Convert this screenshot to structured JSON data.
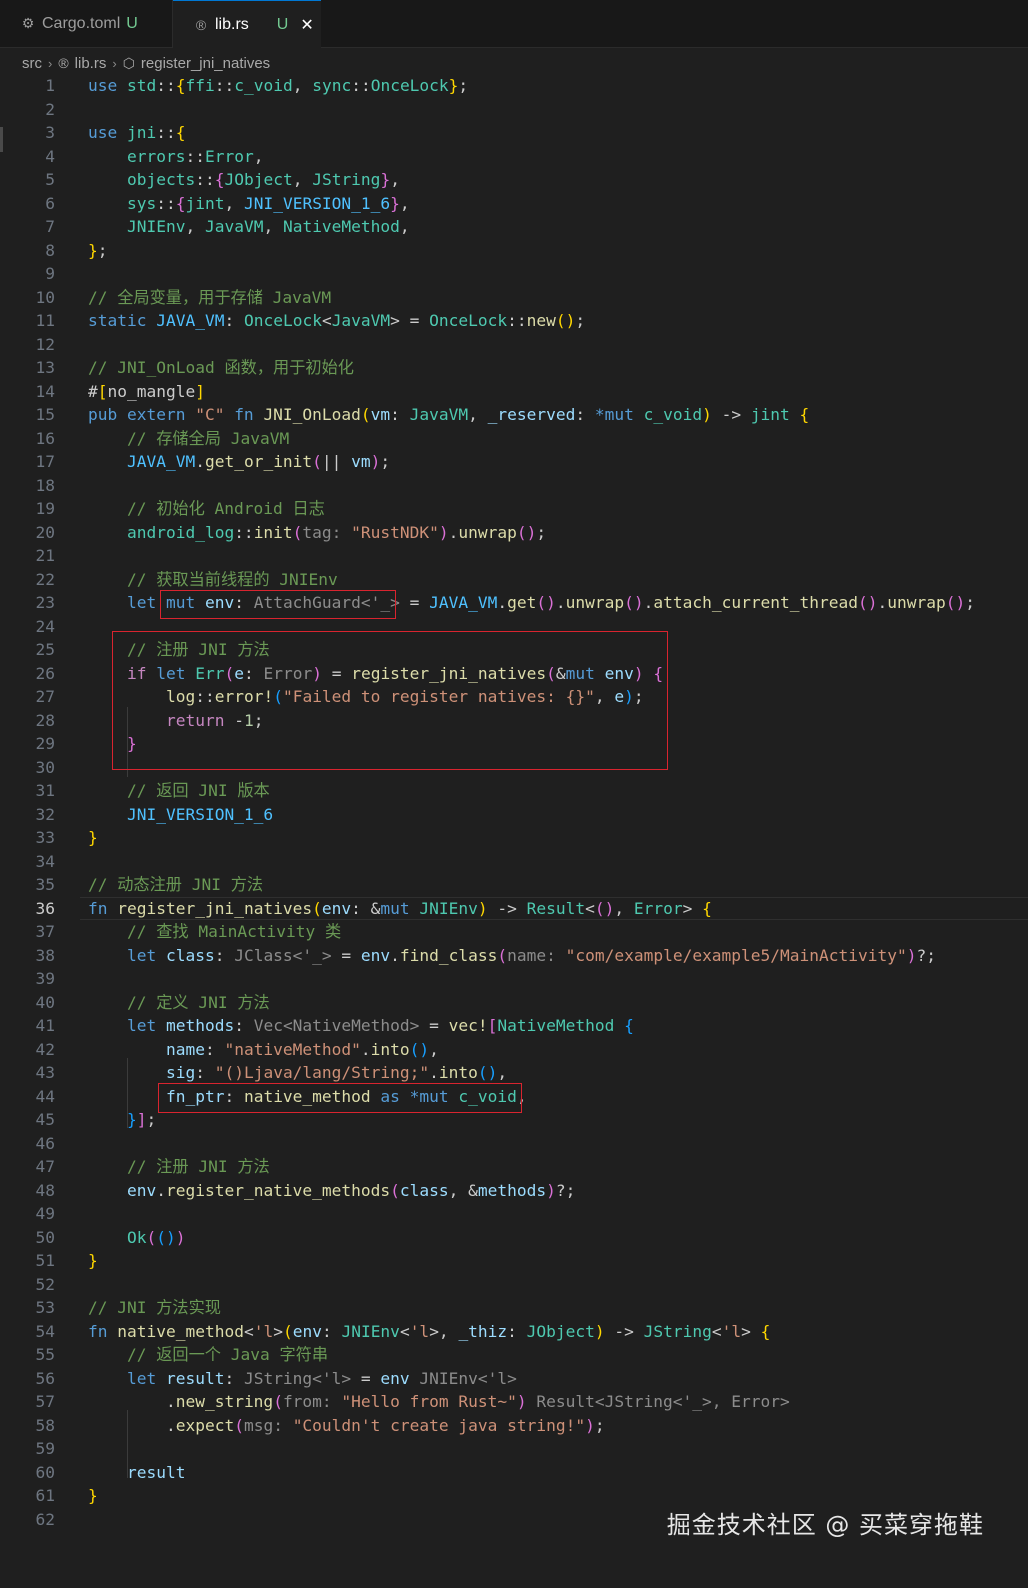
{
  "tabs": [
    {
      "icon": "gear-icon",
      "label": "Cargo.toml",
      "status": "U"
    },
    {
      "icon": "rust-icon",
      "label": "lib.rs",
      "status": "U",
      "close": "✕"
    }
  ],
  "breadcrumb": [
    "src",
    "lib.rs",
    "register_jni_natives"
  ],
  "active_line": 36,
  "lines": [
    [
      [
        "k",
        "use "
      ],
      [
        "t",
        "std"
      ],
      [
        "p",
        "::"
      ],
      [
        "y",
        "{"
      ],
      [
        "t",
        "ffi"
      ],
      [
        "p",
        "::"
      ],
      [
        "t",
        "c_void"
      ],
      [
        "p",
        ", "
      ],
      [
        "t",
        "sync"
      ],
      [
        "p",
        "::"
      ],
      [
        "t",
        "OnceLock"
      ],
      [
        "y",
        "}"
      ],
      [
        "p",
        ";"
      ]
    ],
    [],
    [
      [
        "k",
        "use "
      ],
      [
        "t",
        "jni"
      ],
      [
        "p",
        "::"
      ],
      [
        "y",
        "{"
      ]
    ],
    [
      [
        "p",
        "    "
      ],
      [
        "t",
        "errors"
      ],
      [
        "p",
        "::"
      ],
      [
        "t",
        "Error"
      ],
      [
        "p",
        ","
      ]
    ],
    [
      [
        "p",
        "    "
      ],
      [
        "t",
        "objects"
      ],
      [
        "p",
        "::"
      ],
      [
        "pk",
        "{"
      ],
      [
        "t",
        "JObject"
      ],
      [
        "p",
        ", "
      ],
      [
        "t",
        "JString"
      ],
      [
        "pk",
        "}"
      ],
      [
        "p",
        ","
      ]
    ],
    [
      [
        "p",
        "    "
      ],
      [
        "t",
        "sys"
      ],
      [
        "p",
        "::"
      ],
      [
        "pk",
        "{"
      ],
      [
        "t",
        "jint"
      ],
      [
        "p",
        ", "
      ],
      [
        "cn",
        "JNI_VERSION_1_6"
      ],
      [
        "pk",
        "}"
      ],
      [
        "p",
        ","
      ]
    ],
    [
      [
        "p",
        "    "
      ],
      [
        "t",
        "JNIEnv"
      ],
      [
        "p",
        ", "
      ],
      [
        "t",
        "JavaVM"
      ],
      [
        "p",
        ", "
      ],
      [
        "t",
        "NativeMethod"
      ],
      [
        "p",
        ","
      ]
    ],
    [
      [
        "y",
        "}"
      ],
      [
        "p",
        ";"
      ]
    ],
    [],
    [
      [
        "c",
        "// 全局变量，用于存储 JavaVM"
      ]
    ],
    [
      [
        "k",
        "static "
      ],
      [
        "cn",
        "JAVA_VM"
      ],
      [
        "p",
        ": "
      ],
      [
        "t",
        "OnceLock"
      ],
      [
        "p",
        "<"
      ],
      [
        "t",
        "JavaVM"
      ],
      [
        "p",
        "> = "
      ],
      [
        "t",
        "OnceLock"
      ],
      [
        "p",
        "::"
      ],
      [
        "f",
        "new"
      ],
      [
        "y",
        "()"
      ],
      [
        "p",
        ";"
      ]
    ],
    [],
    [
      [
        "c",
        "// JNI_OnLoad 函数，用于初始化"
      ]
    ],
    [
      [
        "p",
        "#"
      ],
      [
        "y",
        "["
      ],
      [
        "p",
        "no_mangle"
      ],
      [
        "y",
        "]"
      ]
    ],
    [
      [
        "k",
        "pub extern "
      ],
      [
        "s",
        "\"C\" "
      ],
      [
        "k",
        "fn "
      ],
      [
        "f",
        "JNI_OnLoad"
      ],
      [
        "y",
        "("
      ],
      [
        "v",
        "vm"
      ],
      [
        "p",
        ": "
      ],
      [
        "t",
        "JavaVM"
      ],
      [
        "p",
        ", "
      ],
      [
        "v",
        "_reserved"
      ],
      [
        "p",
        ": "
      ],
      [
        "k",
        "*mut "
      ],
      [
        "t",
        "c_void"
      ],
      [
        "y",
        ")"
      ],
      [
        "p",
        " -> "
      ],
      [
        "t",
        "jint"
      ],
      [
        "p",
        " "
      ],
      [
        "y",
        "{"
      ]
    ],
    [
      [
        "p",
        "    "
      ],
      [
        "c",
        "// 存储全局 JavaVM"
      ]
    ],
    [
      [
        "p",
        "    "
      ],
      [
        "cn",
        "JAVA_VM"
      ],
      [
        "p",
        "."
      ],
      [
        "f",
        "get_or_init"
      ],
      [
        "pk",
        "("
      ],
      [
        "p",
        "|| "
      ],
      [
        "v",
        "vm"
      ],
      [
        "pk",
        ")"
      ],
      [
        "p",
        ";"
      ]
    ],
    [],
    [
      [
        "p",
        "    "
      ],
      [
        "c",
        "// 初始化 Android 日志"
      ]
    ],
    [
      [
        "p",
        "    "
      ],
      [
        "t",
        "android_log"
      ],
      [
        "p",
        "::"
      ],
      [
        "f",
        "init"
      ],
      [
        "pk",
        "("
      ],
      [
        "h",
        "tag: "
      ],
      [
        "s",
        "\"RustNDK\""
      ],
      [
        "pk",
        ")"
      ],
      [
        "p",
        "."
      ],
      [
        "f",
        "unwrap"
      ],
      [
        "pk",
        "()"
      ],
      [
        "p",
        ";"
      ]
    ],
    [],
    [
      [
        "p",
        "    "
      ],
      [
        "c",
        "// 获取当前线程的 JNIEnv"
      ]
    ],
    [
      [
        "p",
        "    "
      ],
      [
        "k",
        "let "
      ],
      [
        "k",
        "mut "
      ],
      [
        "v",
        "env"
      ],
      [
        "p",
        ": "
      ],
      [
        "h",
        "AttachGuard<'_>"
      ],
      [
        "p",
        " = "
      ],
      [
        "cn",
        "JAVA_VM"
      ],
      [
        "p",
        "."
      ],
      [
        "f",
        "get"
      ],
      [
        "pk",
        "()"
      ],
      [
        "p",
        "."
      ],
      [
        "f",
        "unwrap"
      ],
      [
        "pk",
        "()"
      ],
      [
        "p",
        "."
      ],
      [
        "f",
        "attach_current_thread"
      ],
      [
        "pk",
        "()"
      ],
      [
        "p",
        "."
      ],
      [
        "f",
        "unwrap"
      ],
      [
        "pk",
        "()"
      ],
      [
        "p",
        ";"
      ]
    ],
    [],
    [
      [
        "p",
        "    "
      ],
      [
        "c",
        "// 注册 JNI 方法"
      ]
    ],
    [
      [
        "p",
        "    "
      ],
      [
        "m",
        "if "
      ],
      [
        "k",
        "let "
      ],
      [
        "t",
        "Err"
      ],
      [
        "pk",
        "("
      ],
      [
        "v",
        "e"
      ],
      [
        "p",
        ": "
      ],
      [
        "h",
        "Error"
      ],
      [
        "pk",
        ")"
      ],
      [
        "p",
        " = "
      ],
      [
        "f",
        "register_jni_natives"
      ],
      [
        "pk",
        "("
      ],
      [
        "p",
        "&"
      ],
      [
        "k",
        "mut "
      ],
      [
        "v",
        "env"
      ],
      [
        "pk",
        ")"
      ],
      [
        "p",
        " "
      ],
      [
        "pk",
        "{"
      ]
    ],
    [
      [
        "p",
        "        "
      ],
      [
        "f",
        "log"
      ],
      [
        "p",
        "::"
      ],
      [
        "f",
        "error!"
      ],
      [
        "bl",
        "("
      ],
      [
        "s",
        "\"Failed to register natives: {}\""
      ],
      [
        "p",
        ", "
      ],
      [
        "v",
        "e"
      ],
      [
        "bl",
        ")"
      ],
      [
        "p",
        ";"
      ]
    ],
    [
      [
        "p",
        "        "
      ],
      [
        "m",
        "return "
      ],
      [
        "p",
        "-"
      ],
      [
        "n",
        "1"
      ],
      [
        "p",
        ";"
      ]
    ],
    [
      [
        "p",
        "    "
      ],
      [
        "pk",
        "}"
      ]
    ],
    [],
    [
      [
        "p",
        "    "
      ],
      [
        "c",
        "// 返回 JNI 版本"
      ]
    ],
    [
      [
        "p",
        "    "
      ],
      [
        "cn",
        "JNI_VERSION_1_6"
      ]
    ],
    [
      [
        "y",
        "}"
      ]
    ],
    [],
    [
      [
        "c",
        "// 动态注册 JNI 方法"
      ]
    ],
    [
      [
        "k",
        "fn "
      ],
      [
        "f",
        "register_jni_natives"
      ],
      [
        "y",
        "("
      ],
      [
        "v",
        "env"
      ],
      [
        "p",
        ": &"
      ],
      [
        "k",
        "mut "
      ],
      [
        "t",
        "JNIEnv"
      ],
      [
        "y",
        ")"
      ],
      [
        "p",
        " -> "
      ],
      [
        "t",
        "Result"
      ],
      [
        "p",
        "<"
      ],
      [
        "pk",
        "()"
      ],
      [
        "p",
        ", "
      ],
      [
        "t",
        "Error"
      ],
      [
        "p",
        "> "
      ],
      [
        "y",
        "{"
      ]
    ],
    [
      [
        "p",
        "    "
      ],
      [
        "c",
        "// 查找 MainActivity 类"
      ]
    ],
    [
      [
        "p",
        "    "
      ],
      [
        "k",
        "let "
      ],
      [
        "v",
        "class"
      ],
      [
        "p",
        ": "
      ],
      [
        "h",
        "JClass<'_>"
      ],
      [
        "p",
        " = "
      ],
      [
        "v",
        "env"
      ],
      [
        "p",
        "."
      ],
      [
        "f",
        "find_class"
      ],
      [
        "pk",
        "("
      ],
      [
        "h",
        "name: "
      ],
      [
        "s",
        "\"com/example/example5/MainActivity\""
      ],
      [
        "pk",
        ")"
      ],
      [
        "p",
        "?;"
      ]
    ],
    [],
    [
      [
        "p",
        "    "
      ],
      [
        "c",
        "// 定义 JNI 方法"
      ]
    ],
    [
      [
        "p",
        "    "
      ],
      [
        "k",
        "let "
      ],
      [
        "v",
        "methods"
      ],
      [
        "p",
        ": "
      ],
      [
        "h",
        "Vec<NativeMethod>"
      ],
      [
        "p",
        " = "
      ],
      [
        "f",
        "vec!"
      ],
      [
        "pk",
        "["
      ],
      [
        "t",
        "NativeMethod "
      ],
      [
        "bl",
        "{"
      ]
    ],
    [
      [
        "p",
        "        "
      ],
      [
        "v",
        "name"
      ],
      [
        "p",
        ": "
      ],
      [
        "s",
        "\"nativeMethod\""
      ],
      [
        "p",
        "."
      ],
      [
        "f",
        "into"
      ],
      [
        "bl",
        "()"
      ],
      [
        "p",
        ","
      ]
    ],
    [
      [
        "p",
        "        "
      ],
      [
        "v",
        "sig"
      ],
      [
        "p",
        ": "
      ],
      [
        "s",
        "\"()Ljava/lang/String;\""
      ],
      [
        "p",
        "."
      ],
      [
        "f",
        "into"
      ],
      [
        "bl",
        "()"
      ],
      [
        "p",
        ","
      ]
    ],
    [
      [
        "p",
        "        "
      ],
      [
        "v",
        "fn_ptr"
      ],
      [
        "p",
        ": "
      ],
      [
        "f",
        "native_method"
      ],
      [
        "p",
        " "
      ],
      [
        "k",
        "as "
      ],
      [
        "k",
        "*mut "
      ],
      [
        "t",
        "c_void"
      ],
      [
        "p",
        ","
      ]
    ],
    [
      [
        "p",
        "    "
      ],
      [
        "bl",
        "}"
      ],
      [
        "pk",
        "]"
      ],
      [
        "p",
        ";"
      ]
    ],
    [],
    [
      [
        "p",
        "    "
      ],
      [
        "c",
        "// 注册 JNI 方法"
      ]
    ],
    [
      [
        "p",
        "    "
      ],
      [
        "v",
        "env"
      ],
      [
        "p",
        "."
      ],
      [
        "f",
        "register_native_methods"
      ],
      [
        "pk",
        "("
      ],
      [
        "v",
        "class"
      ],
      [
        "p",
        ", &"
      ],
      [
        "v",
        "methods"
      ],
      [
        "pk",
        ")"
      ],
      [
        "p",
        "?;"
      ]
    ],
    [],
    [
      [
        "p",
        "    "
      ],
      [
        "t",
        "Ok"
      ],
      [
        "pk",
        "("
      ],
      [
        "bl",
        "()"
      ],
      [
        "pk",
        ")"
      ]
    ],
    [
      [
        "y",
        "}"
      ]
    ],
    [],
    [
      [
        "c",
        "// JNI 方法实现"
      ]
    ],
    [
      [
        "k",
        "fn "
      ],
      [
        "f",
        "native_method"
      ],
      [
        "p",
        "<"
      ],
      [
        "s",
        "'l"
      ],
      [
        "p",
        ">"
      ],
      [
        "y",
        "("
      ],
      [
        "v",
        "env"
      ],
      [
        "p",
        ": "
      ],
      [
        "t",
        "JNIEnv"
      ],
      [
        "p",
        "<"
      ],
      [
        "s",
        "'l"
      ],
      [
        "p",
        ">, "
      ],
      [
        "v",
        "_thiz"
      ],
      [
        "p",
        ": "
      ],
      [
        "t",
        "JObject"
      ],
      [
        "y",
        ")"
      ],
      [
        "p",
        " -> "
      ],
      [
        "t",
        "JString"
      ],
      [
        "p",
        "<"
      ],
      [
        "s",
        "'l"
      ],
      [
        "p",
        "> "
      ],
      [
        "y",
        "{"
      ]
    ],
    [
      [
        "p",
        "    "
      ],
      [
        "c",
        "// 返回一个 Java 字符串"
      ]
    ],
    [
      [
        "p",
        "    "
      ],
      [
        "k",
        "let "
      ],
      [
        "v",
        "result"
      ],
      [
        "p",
        ": "
      ],
      [
        "h",
        "JString<'l>"
      ],
      [
        "p",
        " = "
      ],
      [
        "v",
        "env"
      ],
      [
        "h",
        " JNIEnv<'l>"
      ]
    ],
    [
      [
        "p",
        "        ."
      ],
      [
        "f",
        "new_string"
      ],
      [
        "pk",
        "("
      ],
      [
        "h",
        "from: "
      ],
      [
        "s",
        "\"Hello from Rust~\""
      ],
      [
        "pk",
        ")"
      ],
      [
        "h",
        " Result<JString<'_>, Error>"
      ]
    ],
    [
      [
        "p",
        "        ."
      ],
      [
        "f",
        "expect"
      ],
      [
        "pk",
        "("
      ],
      [
        "h",
        "msg: "
      ],
      [
        "s",
        "\"Couldn't create java string!\""
      ],
      [
        "pk",
        ")"
      ],
      [
        "p",
        ";"
      ]
    ],
    [],
    [
      [
        "p",
        "    "
      ],
      [
        "v",
        "result"
      ]
    ],
    [
      [
        "y",
        "}"
      ]
    ],
    []
  ],
  "watermark": "掘金技术社区 @ 买菜穿拖鞋"
}
